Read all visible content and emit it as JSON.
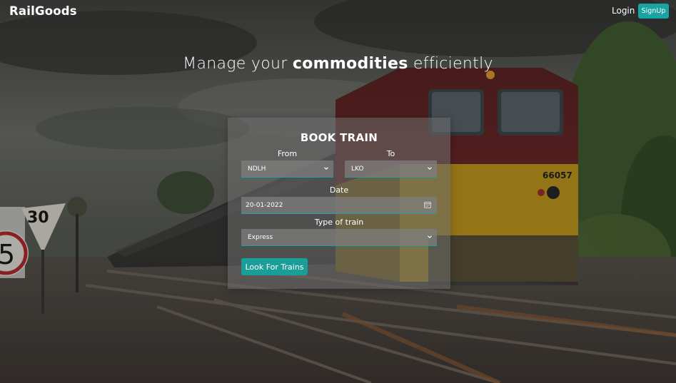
{
  "nav": {
    "brand": "RailGoods",
    "login_label": "Login",
    "signup_label": "SignUp"
  },
  "hero": {
    "prefix": "Manage your ",
    "emphasis": "commodities",
    "suffix": " efficiently"
  },
  "booking": {
    "title": "BOOK TRAIN",
    "from_label": "From",
    "from_value": "NDLH",
    "to_label": "To",
    "to_value": "LKO",
    "date_label": "Date",
    "date_value": "20-01-2022",
    "train_type_label": "Type of train",
    "train_type_value": "Express",
    "submit_label": "Look For Trains"
  },
  "icons": {
    "select_arrow": "chevron-down-icon",
    "date_picker": "calendar-icon"
  },
  "colors": {
    "accent": "#19a3a3",
    "card_bg": "rgba(110,110,110,0.55)"
  }
}
